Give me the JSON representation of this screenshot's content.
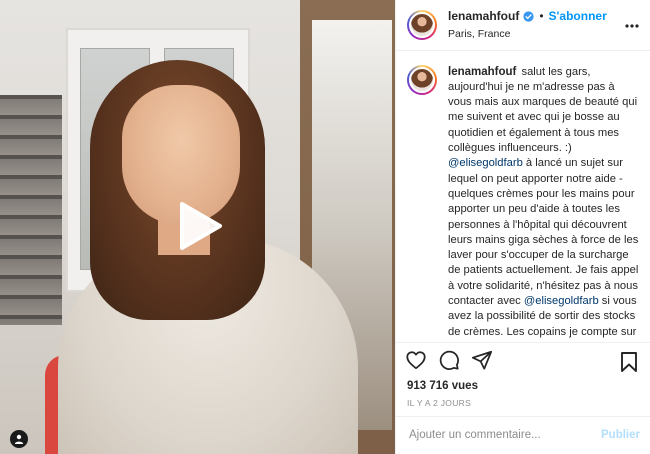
{
  "post": {
    "username": "lenamahfouf",
    "follow_label": "S'abonner",
    "separator": "•",
    "location": "Paris, France",
    "more_icon": "ellipsis-icon"
  },
  "caption": {
    "username": "lenamahfouf",
    "part1": "salut les gars, aujourd'hui je ne m'adresse pas à vous mais aux marques de beauté qui me suivent et avec qui je bosse au quotidien et également à tous mes collègues influenceurs. :)",
    "mention1": "@elisegoldfarb",
    "part2": " à lancé un sujet sur lequel on peut apporter notre aide - quelques crèmes pour les mains pour apporter un peu d'aide à toutes les personnes à l'hôpital qui découvrent leurs mains giga sèches à force de les laver pour s'occuper de la surcharge de patients actuellement. Je fais appel à votre solidarité, n'hésitez pas à nous contacter avec ",
    "mention2": "@elisegoldfarb",
    "part3": " si vous avez la possibilité de sortir des stocks de crèmes. Les copains je compte sur vous pour partager le message aux"
  },
  "stats": {
    "views": "913 716 vues",
    "date": "IL Y A 2 JOURS"
  },
  "comment": {
    "placeholder": "Ajouter un commentaire...",
    "publish_label": "Publier"
  },
  "colors": {
    "accent_blue": "#0095f6",
    "publish_disabled": "#b2dffc",
    "mention": "#00376b",
    "text": "#262626",
    "muted": "#8e8e8e"
  },
  "icons": [
    "play-icon",
    "verified-badge-icon",
    "ellipsis-icon",
    "heart-icon",
    "comment-icon",
    "share-icon",
    "bookmark-icon",
    "user-tag-icon"
  ]
}
